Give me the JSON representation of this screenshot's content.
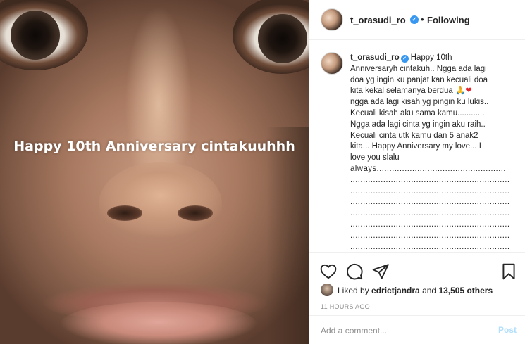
{
  "post": {
    "image_caption": "Happy 10th Anniversary cintakuuhhh"
  },
  "header": {
    "username": "t_orasudi_ro",
    "separator": "•",
    "follow_status": "Following"
  },
  "caption": {
    "username": "t_orasudi_ro",
    "lines": [
      "Happy 10th",
      "Anniversaryh cintakuh.. Ngga ada lagi",
      "doa yg ingin ku panjat kan kecuali doa",
      "kita kekal selamanya berdua",
      "ngga ada lagi kisah yg pingin ku lukis..",
      "Kecuali kisah aku sama kamu.......... .",
      "Ngga ada lagi cinta yg ingin aku raih..",
      "Kecuali cinta utk kamu dan 5 anak2",
      "kita... Happy Anniversary my love... I",
      "love you slalu",
      "always..................................................."
    ],
    "emoji_pray": "🙏",
    "emoji_heart": "❤",
    "dot_lines": [
      "........................................................................",
      "........................................................................",
      "........................................................................",
      "........................................................................",
      "........................................................................",
      "........................................................................",
      "........................................................................",
      "........................................................................"
    ]
  },
  "actions": {
    "like_icon": "heart-icon",
    "comment_icon": "comment-icon",
    "share_icon": "paper-plane-icon",
    "save_icon": "bookmark-icon"
  },
  "likes": {
    "prefix": "Liked by ",
    "user": "edrictjandra",
    "middle": " and ",
    "count": "13,505 others"
  },
  "timestamp": "11 HOURS AGO",
  "comment_form": {
    "placeholder": "Add a comment...",
    "post_label": "Post"
  },
  "colors": {
    "verified_badge": "#3897f0",
    "post_button_disabled": "#b2dffc",
    "text": "#262626",
    "muted": "#8e8e8e"
  }
}
